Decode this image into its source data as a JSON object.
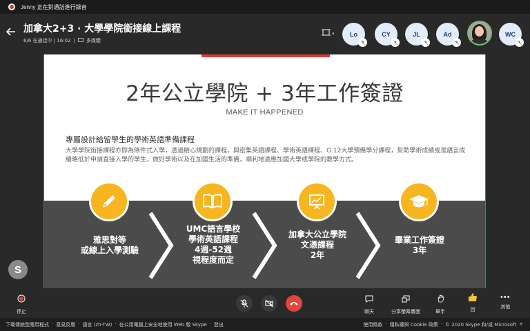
{
  "recording": {
    "text": "Jenny 正在對通話進行錄音"
  },
  "header": {
    "title": "加拿大2+3 · 大學學院銜接線上課程",
    "date_duration": "6/6 在通話中 | 16:02",
    "chat_label": "多媒體"
  },
  "participants": [
    {
      "initials": "Lo"
    },
    {
      "initials": "CY"
    },
    {
      "initials": "JL"
    },
    {
      "initials": "Ad"
    },
    {
      "initials": ""
    },
    {
      "initials": "WC"
    }
  ],
  "slide": {
    "title": "2年公立學院 + 3年工作簽證",
    "subtitle": "MAKE IT HAPPENED",
    "heading": "專屬設計給留學生的學術英語準備課程",
    "paragraph": "大學學院銜接課程亦即為條件式入學，透過精心規劃的課程，與密集英語課程、學術英語課程、G.12大學預備學分課程，幫助學術成績或是語言成績略低於申請直接入學的學生，做好學術以及在加國生活的準備，順利地適應加國大學或學院的教學方式。",
    "steps": [
      {
        "lines": [
          "雅思對等",
          "或線上入學測驗"
        ],
        "icon": "pencil-icon"
      },
      {
        "lines": [
          "UMC語言學校",
          "學術英語課程",
          "4週-52週",
          "視程度而定"
        ],
        "icon": "book-icon"
      },
      {
        "lines": [
          "加拿大公立學院",
          "文憑課程",
          "2年"
        ],
        "icon": "presentation-board-icon"
      },
      {
        "lines": [
          "畢業工作簽證",
          "3年"
        ],
        "icon": "graduation-cap-icon"
      }
    ],
    "colors": {
      "accent_yellow": "#f7b51f",
      "band_gray": "#4b4b4b",
      "top_red": "#e3392e"
    }
  },
  "s_avatar": {
    "letter": "S"
  },
  "controls": {
    "stop_label": "停止",
    "chat_label": "聊天",
    "share_label": "分享螢幕畫面",
    "raise_hand_label": "舉手",
    "react_label": "回",
    "more_label": "其他"
  },
  "footer": {
    "left": [
      "下載傳統型應用程式",
      "意見反應",
      "語言 (zh-TW)",
      "在公用電腦上安全地使用 Web 版 Skype",
      "登出"
    ],
    "right": [
      "使用條款",
      "隱私權與 Cookie 政策",
      "© 2020 Skype 和/或 Microsoft"
    ]
  }
}
